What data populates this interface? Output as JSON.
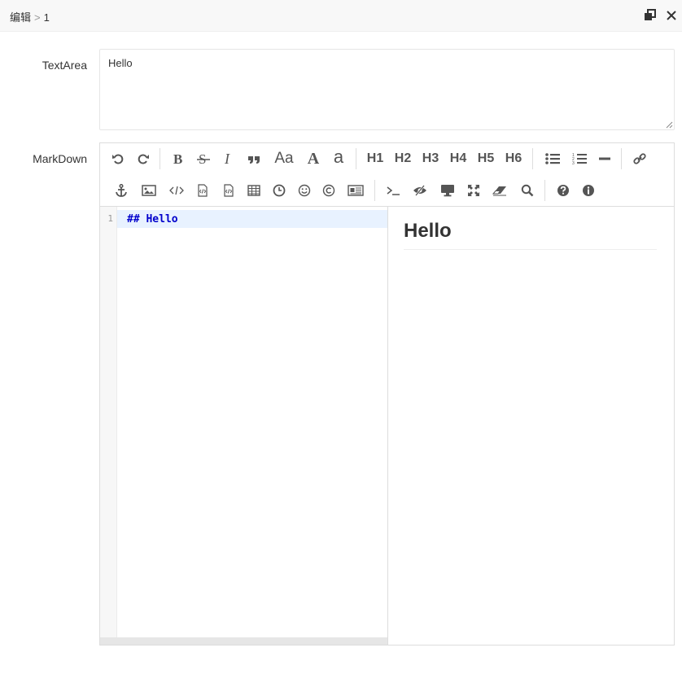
{
  "window": {
    "breadcrumb_root": "编辑",
    "breadcrumb_sep": ">",
    "breadcrumb_leaf": "1"
  },
  "form": {
    "textarea_label": "TextArea",
    "textarea_value": "Hello",
    "markdown_label": "MarkDown"
  },
  "toolbar": {
    "h1": "H1",
    "h2": "H2",
    "h3": "H3",
    "h4": "H4",
    "h5": "H5",
    "h6": "H6",
    "upper": "Aa",
    "serif_a": "A",
    "lower_a": "a"
  },
  "editor": {
    "line_number": "1",
    "code": "## Hello"
  },
  "preview": {
    "heading": "Hello"
  },
  "colors": {
    "accent_active_line": "#e8f2ff",
    "code_text": "#0000cc"
  }
}
